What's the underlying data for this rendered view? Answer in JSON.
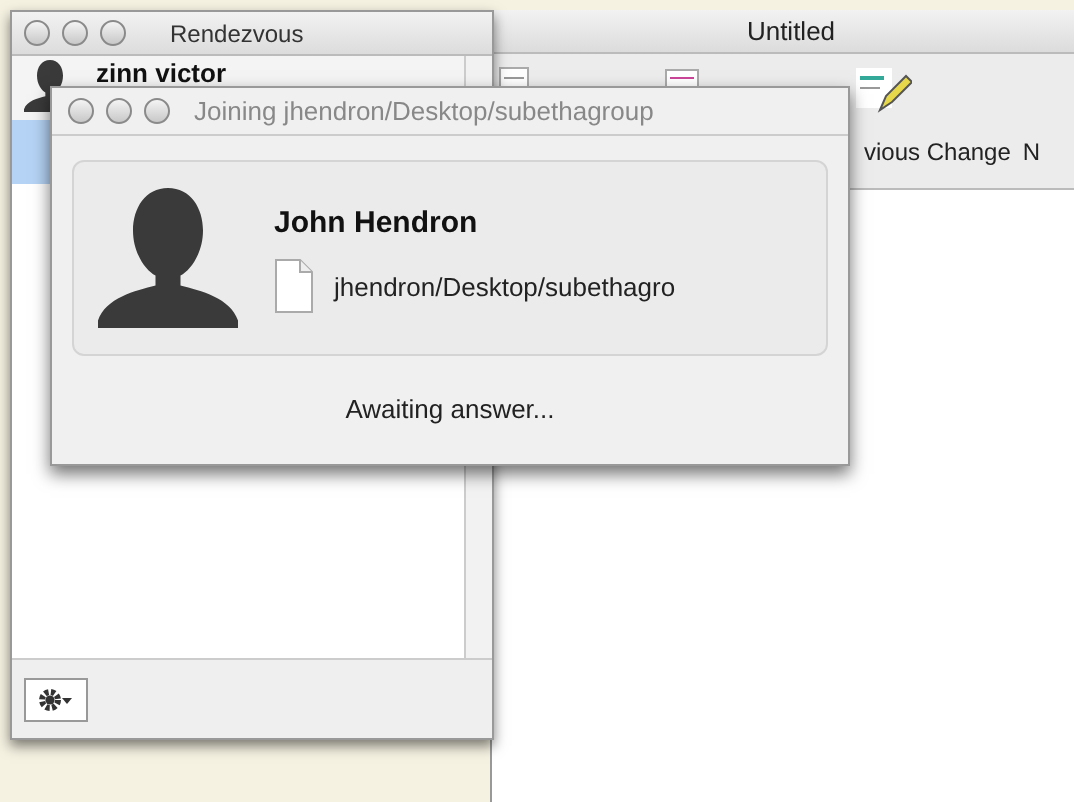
{
  "rendezvous_window": {
    "title": "Rendezvous",
    "users": [
      {
        "name": "zinn victor",
        "selected": false
      },
      {
        "selected": true
      }
    ]
  },
  "document_window": {
    "title": "Untitled",
    "toolbar": [
      {
        "label": "vious Change"
      },
      {
        "label": "N"
      }
    ]
  },
  "join_dialog": {
    "title": "Joining jhendron/Desktop/subethagroup",
    "user": "John Hendron",
    "document": "jhendron/Desktop/subethagro",
    "status": "Awaiting answer..."
  }
}
